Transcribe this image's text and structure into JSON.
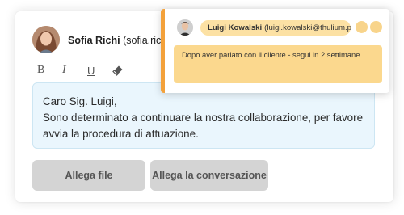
{
  "composer": {
    "sender_name": "Sofia Richi",
    "sender_email": "(sofia.richi@t",
    "toolbar": {
      "bold": "B",
      "italic": "I",
      "underline": "U",
      "eraser_icon": "eraser-icon"
    },
    "message_lines": [
      "Caro Sig. Luigi,",
      "Sono determinato a continuare la nostra collaborazione, per favore",
      "avvia la procedura di attuazione."
    ],
    "buttons": {
      "attach_file": "Allega file",
      "attach_conversation": "Allega la conversazione"
    }
  },
  "note": {
    "recipient_name": "Luigi Kowalski",
    "recipient_email": "(luigi.kowalski@thulium.pl)",
    "text": "Dopo aver parlato con il cliente - segui in 2 settimane."
  },
  "colors": {
    "message_bg": "#eaf6fd",
    "note_accent": "#f3a13a",
    "note_bg": "#fbd88e",
    "button_bg": "#d4d4d4"
  }
}
